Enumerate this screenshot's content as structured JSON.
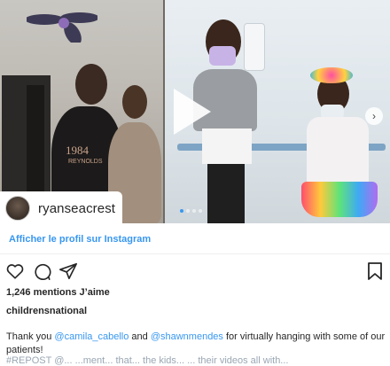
{
  "post": {
    "username": "ryanseacrest",
    "profile_link": "Afficher le profil sur Instagram",
    "likes": "1,246 mentions J’aime",
    "account": "childrensnational",
    "caption": {
      "text_1": "Thank you ",
      "mention_1": "@camila_cabello",
      "text_2": " and ",
      "mention_2": "@shawnmendes",
      "text_3": " for virtually hanging with some of our patients!",
      "cut_line": "#REPOST @... ...ment... that... the kids...  ... their videos all with..."
    },
    "carousel": {
      "slide_count": 4,
      "active_slide": 0
    },
    "shirt_text": {
      "left": "1984",
      "left_sub": "REYNOLDS"
    }
  },
  "icons": {
    "play": "play-icon",
    "next": "chevron-right-icon",
    "like": "heart-icon",
    "comment": "comment-icon",
    "share": "share-icon",
    "save": "bookmark-icon"
  }
}
